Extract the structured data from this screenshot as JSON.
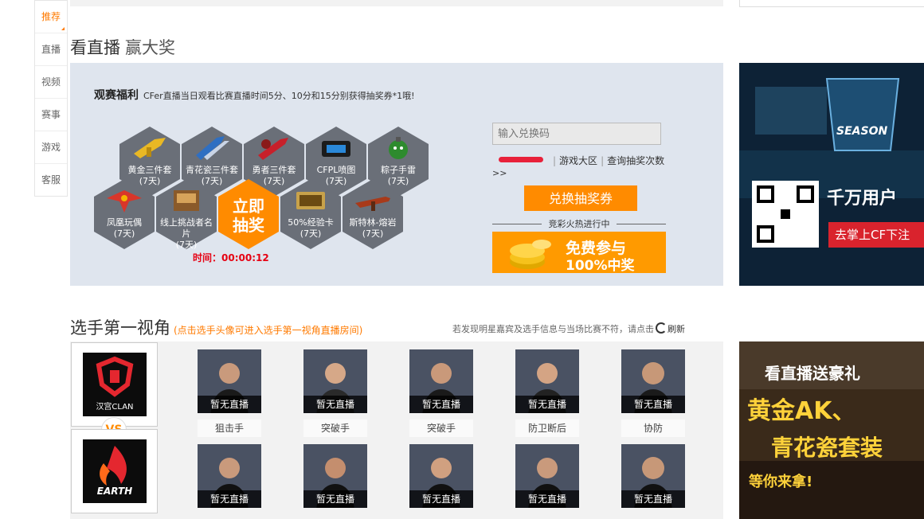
{
  "nav": {
    "items": [
      "推荐",
      "直播",
      "视频",
      "赛事",
      "游戏",
      "客服"
    ],
    "active_index": 0
  },
  "section1": {
    "title": "看直播",
    "subtitle": "赢大奖"
  },
  "welfare": {
    "label": "观赛福利",
    "description": "CFer直播当日观看比赛直播时间5分、10分和15分别获得抽奖券*1哦!",
    "prizes": [
      {
        "name": "黄金三件套",
        "days": "(7天)"
      },
      {
        "name": "青花瓷三件套",
        "days": "(7天)"
      },
      {
        "name": "勇者三件套",
        "days": "(7天)"
      },
      {
        "name": "CFPL喷图",
        "days": "(7天)"
      },
      {
        "name": "粽子手雷",
        "days": "(7天)"
      },
      {
        "name": "凤凰玩偶",
        "days": "(7天)"
      },
      {
        "name": "线上挑战者名片",
        "days": "(7天)"
      },
      {
        "name": "50%经验卡",
        "days": "(7天)"
      },
      {
        "name": "斯特林-熔岩",
        "days": "(7天)"
      }
    ],
    "center_button_line1": "立即",
    "center_button_line2": "抽奖",
    "card_text": "50%经验卡",
    "timer": "时间：00:00:12",
    "code_placeholder": "输入兑换码",
    "link_lobby": "游戏大区",
    "link_query": "查询抽奖次数",
    "more": ">>",
    "exchange_button": "兑换抽奖券",
    "hot_text": "竞彩火热进行中",
    "free_line1": "免费参与",
    "free_line2": "100%中奖"
  },
  "ads": {
    "ad1": {
      "season": "SEASON",
      "line1": "千万用户",
      "line2": "去掌上CF下注"
    },
    "ad2": {
      "line1": "看直播送豪礼",
      "line2": "黄金AK、",
      "line3": "青花瓷套装",
      "line4": "等你来拿!"
    }
  },
  "section2": {
    "title": "选手第一视角",
    "note": "(点击选手头像可进入选手第一视角直播房间)",
    "refresh_note": "若发现明星嘉宾及选手信息与当场比赛不符，请点击",
    "refresh_label": "刷新"
  },
  "teams": {
    "team1_logo_text": "汉宫CLAN",
    "vs": "VS",
    "team2_logo_text": "EARTH"
  },
  "players": {
    "status_label": "暂无直播",
    "roles": [
      "狙击手",
      "突破手",
      "突破手",
      "防卫断后",
      "协防"
    ]
  },
  "colors": {
    "accent": "#ff8b00",
    "timer": "#e60012",
    "panel_bg": "#dfe5ee"
  }
}
